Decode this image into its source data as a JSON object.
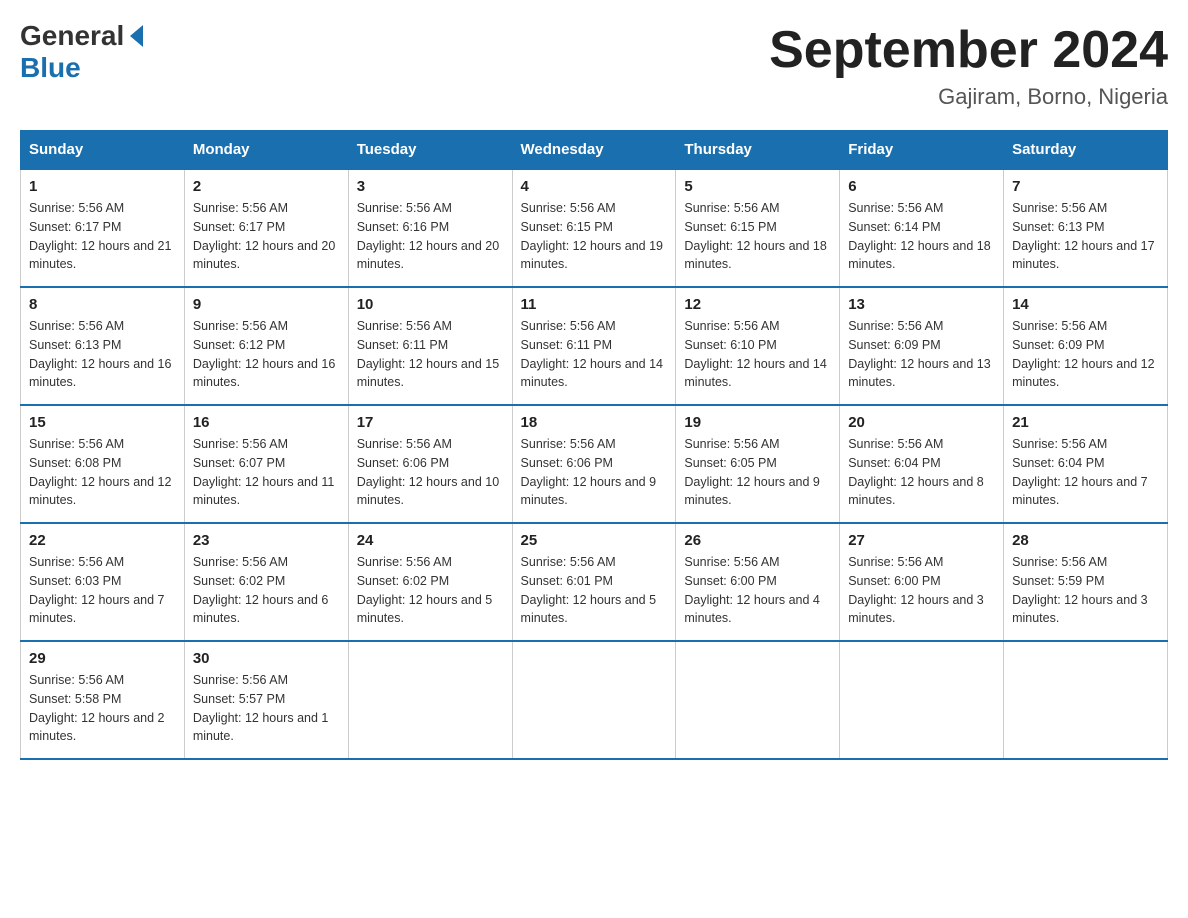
{
  "header": {
    "logo_general": "General",
    "logo_blue": "Blue",
    "title": "September 2024",
    "subtitle": "Gajiram, Borno, Nigeria"
  },
  "days_of_week": [
    "Sunday",
    "Monday",
    "Tuesday",
    "Wednesday",
    "Thursday",
    "Friday",
    "Saturday"
  ],
  "weeks": [
    [
      {
        "day": "1",
        "sunrise": "5:56 AM",
        "sunset": "6:17 PM",
        "daylight": "12 hours and 21 minutes."
      },
      {
        "day": "2",
        "sunrise": "5:56 AM",
        "sunset": "6:17 PM",
        "daylight": "12 hours and 20 minutes."
      },
      {
        "day": "3",
        "sunrise": "5:56 AM",
        "sunset": "6:16 PM",
        "daylight": "12 hours and 20 minutes."
      },
      {
        "day": "4",
        "sunrise": "5:56 AM",
        "sunset": "6:15 PM",
        "daylight": "12 hours and 19 minutes."
      },
      {
        "day": "5",
        "sunrise": "5:56 AM",
        "sunset": "6:15 PM",
        "daylight": "12 hours and 18 minutes."
      },
      {
        "day": "6",
        "sunrise": "5:56 AM",
        "sunset": "6:14 PM",
        "daylight": "12 hours and 18 minutes."
      },
      {
        "day": "7",
        "sunrise": "5:56 AM",
        "sunset": "6:13 PM",
        "daylight": "12 hours and 17 minutes."
      }
    ],
    [
      {
        "day": "8",
        "sunrise": "5:56 AM",
        "sunset": "6:13 PM",
        "daylight": "12 hours and 16 minutes."
      },
      {
        "day": "9",
        "sunrise": "5:56 AM",
        "sunset": "6:12 PM",
        "daylight": "12 hours and 16 minutes."
      },
      {
        "day": "10",
        "sunrise": "5:56 AM",
        "sunset": "6:11 PM",
        "daylight": "12 hours and 15 minutes."
      },
      {
        "day": "11",
        "sunrise": "5:56 AM",
        "sunset": "6:11 PM",
        "daylight": "12 hours and 14 minutes."
      },
      {
        "day": "12",
        "sunrise": "5:56 AM",
        "sunset": "6:10 PM",
        "daylight": "12 hours and 14 minutes."
      },
      {
        "day": "13",
        "sunrise": "5:56 AM",
        "sunset": "6:09 PM",
        "daylight": "12 hours and 13 minutes."
      },
      {
        "day": "14",
        "sunrise": "5:56 AM",
        "sunset": "6:09 PM",
        "daylight": "12 hours and 12 minutes."
      }
    ],
    [
      {
        "day": "15",
        "sunrise": "5:56 AM",
        "sunset": "6:08 PM",
        "daylight": "12 hours and 12 minutes."
      },
      {
        "day": "16",
        "sunrise": "5:56 AM",
        "sunset": "6:07 PM",
        "daylight": "12 hours and 11 minutes."
      },
      {
        "day": "17",
        "sunrise": "5:56 AM",
        "sunset": "6:06 PM",
        "daylight": "12 hours and 10 minutes."
      },
      {
        "day": "18",
        "sunrise": "5:56 AM",
        "sunset": "6:06 PM",
        "daylight": "12 hours and 9 minutes."
      },
      {
        "day": "19",
        "sunrise": "5:56 AM",
        "sunset": "6:05 PM",
        "daylight": "12 hours and 9 minutes."
      },
      {
        "day": "20",
        "sunrise": "5:56 AM",
        "sunset": "6:04 PM",
        "daylight": "12 hours and 8 minutes."
      },
      {
        "day": "21",
        "sunrise": "5:56 AM",
        "sunset": "6:04 PM",
        "daylight": "12 hours and 7 minutes."
      }
    ],
    [
      {
        "day": "22",
        "sunrise": "5:56 AM",
        "sunset": "6:03 PM",
        "daylight": "12 hours and 7 minutes."
      },
      {
        "day": "23",
        "sunrise": "5:56 AM",
        "sunset": "6:02 PM",
        "daylight": "12 hours and 6 minutes."
      },
      {
        "day": "24",
        "sunrise": "5:56 AM",
        "sunset": "6:02 PM",
        "daylight": "12 hours and 5 minutes."
      },
      {
        "day": "25",
        "sunrise": "5:56 AM",
        "sunset": "6:01 PM",
        "daylight": "12 hours and 5 minutes."
      },
      {
        "day": "26",
        "sunrise": "5:56 AM",
        "sunset": "6:00 PM",
        "daylight": "12 hours and 4 minutes."
      },
      {
        "day": "27",
        "sunrise": "5:56 AM",
        "sunset": "6:00 PM",
        "daylight": "12 hours and 3 minutes."
      },
      {
        "day": "28",
        "sunrise": "5:56 AM",
        "sunset": "5:59 PM",
        "daylight": "12 hours and 3 minutes."
      }
    ],
    [
      {
        "day": "29",
        "sunrise": "5:56 AM",
        "sunset": "5:58 PM",
        "daylight": "12 hours and 2 minutes."
      },
      {
        "day": "30",
        "sunrise": "5:56 AM",
        "sunset": "5:57 PM",
        "daylight": "12 hours and 1 minute."
      },
      null,
      null,
      null,
      null,
      null
    ]
  ],
  "labels": {
    "sunrise_prefix": "Sunrise: ",
    "sunset_prefix": "Sunset: ",
    "daylight_prefix": "Daylight: "
  }
}
